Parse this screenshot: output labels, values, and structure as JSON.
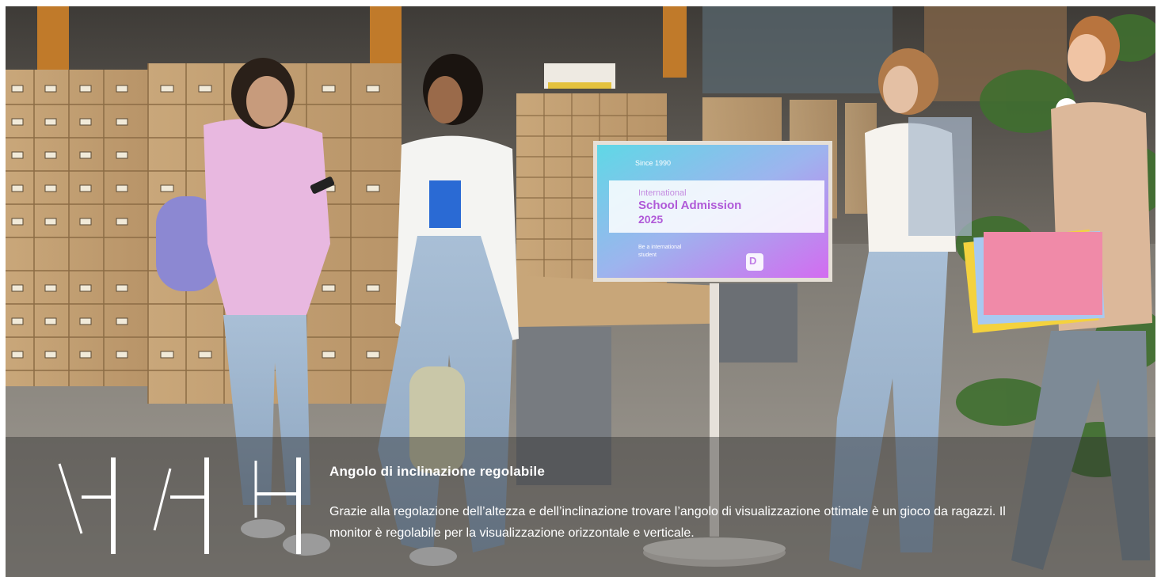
{
  "hero": {
    "image_alt": "Studentesse e studenti in biblioteca accanto al monitor su supporto",
    "monitor_screen": {
      "since": "Since 1990",
      "line1": "International",
      "line2": "School Admission",
      "line3": "2025",
      "tagline_1": "Be a international",
      "tagline_2": "student",
      "logo_letter": "D"
    }
  },
  "feature": {
    "title": "Angolo di inclinazione regolabile",
    "description": "Grazie alla regolazione dell’altezza e dell’inclinazione trovare l’angolo di visualizzazione ottimale è un gioco da ragazzi. Il monitor è regolabile per la visualizzazione orizzontale e verticale.",
    "icons": [
      "tilt-back-icon",
      "tilt-forward-icon",
      "tilt-straight-icon"
    ]
  },
  "colors": {
    "caption_overlay": "rgba(40,40,40,0.42)",
    "text": "#ffffff",
    "screen_gradient_start": "#5fd8e6",
    "screen_gradient_end": "#d36cf0"
  }
}
